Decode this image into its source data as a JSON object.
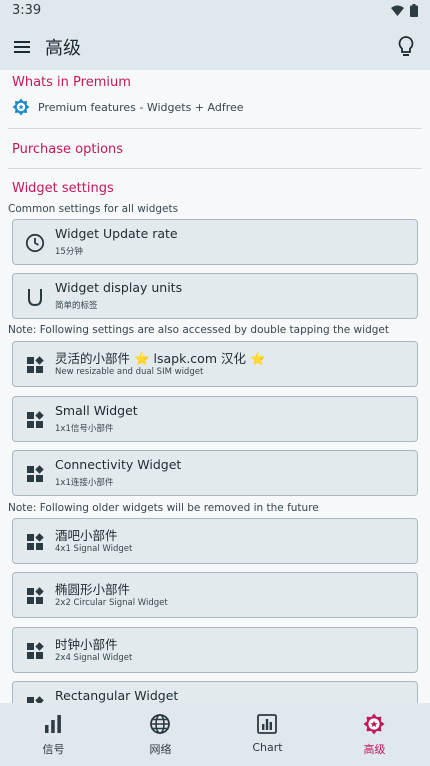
{
  "status_bar": {
    "time": "3:39"
  },
  "app_bar": {
    "title": "高级"
  },
  "sections": {
    "premium_title": "Whats in Premium",
    "premium_item": "Premium features - Widgets + Adfree",
    "purchase_title": "Purchase options",
    "widget_settings_title": "Widget settings",
    "common_note": "Common settings for all widgets",
    "double_tap_note": "Note: Following settings are also accessed by double tapping the widget",
    "older_note": "Note: Following older widgets will be removed in the future"
  },
  "common_cards": [
    {
      "label": "Widget Update rate",
      "sub": "15分钟"
    },
    {
      "label": "Widget display units",
      "sub": "简单的标签"
    }
  ],
  "widget_cards": [
    {
      "label": "灵活的小部件 ⭐ lsapk.com 汉化 ⭐",
      "sub": "New resizable and dual SIM widget"
    },
    {
      "label": "Small Widget",
      "sub": "1x1信号小部件"
    },
    {
      "label": "Connectivity Widget",
      "sub": "1x1连接小部件"
    }
  ],
  "older_cards": [
    {
      "label": "酒吧小部件",
      "sub": "4x1 Signal Widget"
    },
    {
      "label": "椭圆形小部件",
      "sub": "2x2 Circular Signal Widget"
    },
    {
      "label": "时钟小部件",
      "sub": "2x4 Signal Widget"
    },
    {
      "label": "Rectangular Widget",
      "sub": ""
    }
  ],
  "bottom_nav": [
    {
      "label": "信号",
      "icon": "bar-chart-icon"
    },
    {
      "label": "网络",
      "icon": "globe-icon"
    },
    {
      "label": "Chart",
      "icon": "chart-icon"
    },
    {
      "label": "高级",
      "icon": "premium-badge-icon"
    }
  ],
  "colors": {
    "accent": "#c2185b",
    "bar_bg": "#dfe8ec",
    "card_bg": "#e2eaed",
    "premium_icon": "#1e88c8"
  }
}
